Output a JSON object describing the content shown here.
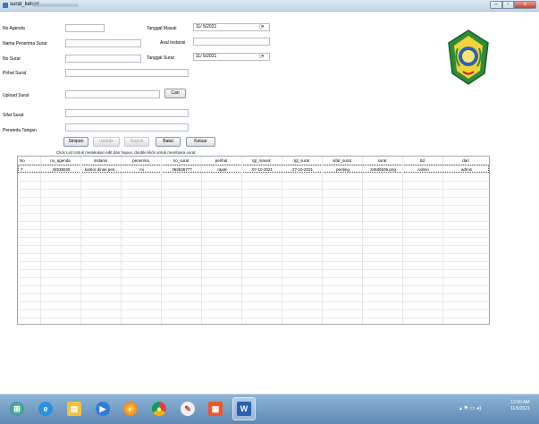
{
  "window": {
    "title": "surat_keluar"
  },
  "form": {
    "no_agenda": {
      "label": "No Agenda",
      "value": ""
    },
    "nama_penerima": {
      "label": "Nama Penerima Surat",
      "value": ""
    },
    "no_surat": {
      "label": "No Surat",
      "value": ""
    },
    "perihal": {
      "label": "Pirhal Surat",
      "value": ""
    },
    "upload": {
      "label": "Upload Surat",
      "value": "",
      "button": "Cari"
    },
    "sifat": {
      "label": "Sifat Surat",
      "value": ""
    },
    "penanda": {
      "label": "Penanda Tangan",
      "value": ""
    },
    "tanggal_masuk": {
      "label": "Tanggal Masuk",
      "value": "11/ 5/2021"
    },
    "asal_instansi": {
      "label": "Asal Instansi",
      "value": ""
    },
    "tanggal_surat": {
      "label": "Tanggal Surat",
      "value": "11/ 5/2021"
    }
  },
  "actions": {
    "simpan": "Simpan",
    "update": "Update",
    "hapus": "Hapus",
    "batal": "Batal",
    "keluar": "Keluar"
  },
  "hint": "Click List Untuk melakukan edit dan hapus. double klick untuk membuka surat",
  "table": {
    "columns": [
      "No",
      "no_agenda",
      "instansi",
      "penerima",
      "no_surat",
      "perihal",
      "tgl_masuk",
      "tgl_surat",
      "sifat_surat",
      "surat",
      "ttd",
      "dari"
    ],
    "rows": [
      [
        "7",
        "34536636",
        "kantor dinas pen...",
        "mi",
        "363636777",
        "rapat",
        "07-10-2021",
        "27-10-2021",
        "penting",
        "34536636.png",
        "Admin",
        "admin"
      ]
    ]
  },
  "taskbar": {
    "icons": [
      "windows-orb-icon",
      "internet-explorer-icon",
      "file-explorer-icon",
      "media-player-icon",
      "firefox-icon",
      "chrome-icon",
      "paint-icon",
      "java-app-icon",
      "word-icon"
    ],
    "clock_time": "12:50 AM",
    "clock_date": "11/5/2021"
  }
}
